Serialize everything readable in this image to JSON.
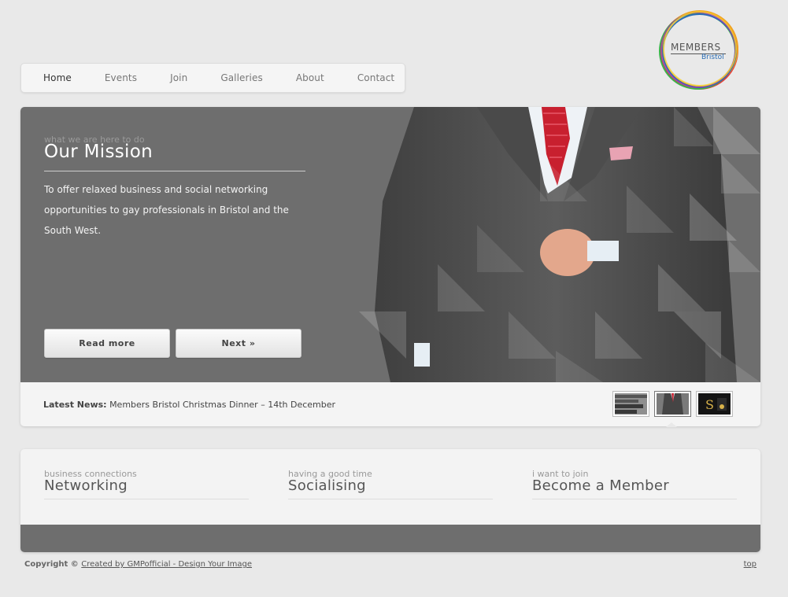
{
  "nav": {
    "items": [
      {
        "label": "Home",
        "active": true
      },
      {
        "label": "Events",
        "active": false
      },
      {
        "label": "Join",
        "active": false
      },
      {
        "label": "Galleries",
        "active": false
      },
      {
        "label": "About",
        "active": false
      },
      {
        "label": "Contact",
        "active": false
      }
    ]
  },
  "logo": {
    "line1": "MEMBERS",
    "line2": "Bristol",
    "ring_colors": [
      "#e53b3b",
      "#f0a020",
      "#f7d12b",
      "#3bb34a",
      "#2a6db5",
      "#8e3bb5"
    ]
  },
  "hero": {
    "kicker": "what we are here to do",
    "title": "Our Mission",
    "text": "To offer relaxed business and social networking opportunities to gay professionals in Bristol and the South West.",
    "read_more_label": "Read more",
    "next_label": "Next »"
  },
  "news": {
    "label": "Latest News:",
    "text": "Members Bristol Christmas Dinner – 14th December"
  },
  "thumbnails": [
    {
      "name": "thumb-text"
    },
    {
      "name": "thumb-suit"
    },
    {
      "name": "thumb-logo"
    }
  ],
  "features": [
    {
      "small": "business connections",
      "big": "Networking"
    },
    {
      "small": "having a good time",
      "big": "Socialising"
    },
    {
      "small": "i want to join",
      "big": "Become a Member"
    }
  ],
  "footer": {
    "copyright": "Copyright ©",
    "credit_link": "Created by GMPofficial - Design Your Image",
    "top_link": "top"
  },
  "colors": {
    "hero_bg": "#6e6e6e",
    "page_bg": "#e9e9e9",
    "tie_red": "#c8202f"
  }
}
